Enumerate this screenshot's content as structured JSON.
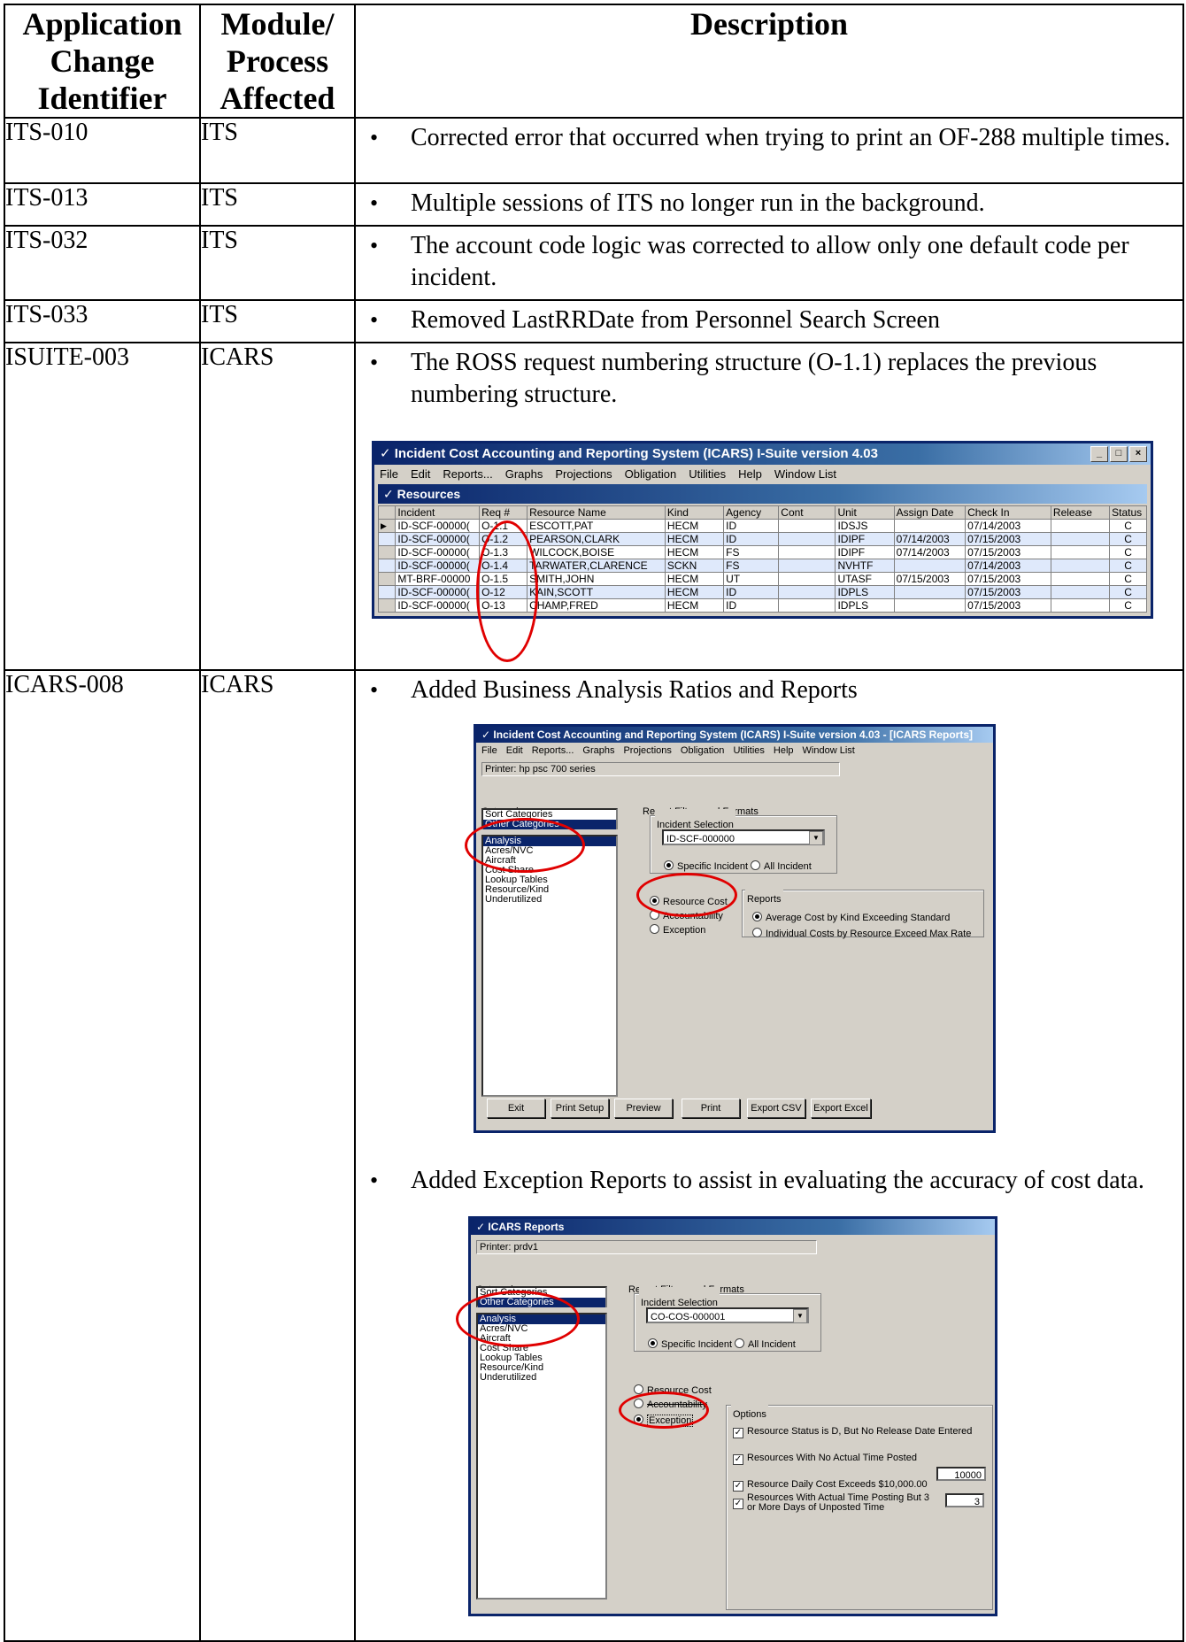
{
  "headers": {
    "identifier": "Application Change Identifier",
    "module": "Module/ Process Affected",
    "description": "Description"
  },
  "rows": [
    {
      "id": "ITS-010",
      "module": "ITS",
      "desc": "Corrected error that occurred when trying to print an OF-288 multiple times."
    },
    {
      "id": "ITS-013",
      "module": "ITS",
      "desc": "Multiple sessions of ITS no longer run in the background."
    },
    {
      "id": "ITS-032",
      "module": "ITS",
      "desc": "The account code logic was corrected to allow only one default code per incident."
    },
    {
      "id": "ITS-033",
      "module": "ITS",
      "desc": "Removed LastRRDate from Personnel Search Screen"
    },
    {
      "id": "ISUITE-003",
      "module": "ICARS",
      "desc": "The ROSS request numbering structure (O-1.1) replaces the previous numbering structure."
    },
    {
      "id": "ICARS-008",
      "module": "ICARS",
      "desc": "Added Business Analysis Ratios and Reports",
      "desc2": "Added Exception Reports to assist in evaluating the accuracy of cost data."
    }
  ],
  "screenshot1": {
    "title": "Incident Cost Accounting and Reporting System (ICARS) I-Suite version 4.03",
    "menu": [
      "File",
      "Edit",
      "Reports...",
      "Graphs",
      "Projections",
      "Obligation",
      "Utilities",
      "Help",
      "Window List"
    ],
    "subwindow": "Resources",
    "columns": [
      "Incident",
      "Req #",
      "Resource Name",
      "Kind",
      "Agency",
      "Cont",
      "Unit",
      "Assign Date",
      "Check In",
      "Release",
      "Status"
    ],
    "rows": [
      [
        "ID-SCF-00000(",
        "O-1.1",
        "ESCOTT,PAT",
        "HECM",
        "ID",
        "",
        "IDSJS",
        "",
        "07/14/2003",
        "",
        "C"
      ],
      [
        "ID-SCF-00000(",
        "O-1.2",
        "PEARSON,CLARK",
        "HECM",
        "ID",
        "",
        "IDIPF",
        "07/14/2003",
        "07/15/2003",
        "",
        "C"
      ],
      [
        "ID-SCF-00000(",
        "O-1.3",
        "WILCOCK,BOISE",
        "HECM",
        "FS",
        "",
        "IDIPF",
        "07/14/2003",
        "07/15/2003",
        "",
        "C"
      ],
      [
        "ID-SCF-00000(",
        "O-1.4",
        "TARWATER,CLARENCE",
        "SCKN",
        "FS",
        "",
        "NVHTF",
        "",
        "07/14/2003",
        "",
        "C"
      ],
      [
        "MT-BRF-00000",
        "O-1.5",
        "SMITH,JOHN",
        "HECM",
        "UT",
        "",
        "UTASF",
        "07/15/2003",
        "07/15/2003",
        "",
        "C"
      ],
      [
        "ID-SCF-00000(",
        "O-12",
        "KAIN,SCOTT",
        "HECM",
        "ID",
        "",
        "IDPLS",
        "",
        "07/15/2003",
        "",
        "C"
      ],
      [
        "ID-SCF-00000(",
        "O-13",
        "CHAMP,FRED",
        "HECM",
        "ID",
        "",
        "IDPLS",
        "",
        "07/15/2003",
        "",
        "C"
      ]
    ]
  },
  "screenshot2": {
    "title": "Incident Cost Accounting and Reporting System (ICARS) I-Suite version 4.03 - [ICARS Reports]",
    "menu": [
      "File",
      "Edit",
      "Reports...",
      "Graphs",
      "Projections",
      "Obligation",
      "Utilities",
      "Help",
      "Window List"
    ],
    "printer": "Printer: hp psc 700 series",
    "categories_label": "Categories",
    "categories_top": [
      "Sort Categories",
      "Other Categories"
    ],
    "categories": [
      "Analysis",
      "Acres/NVC",
      "Aircraft",
      "Cost Share",
      "Lookup Tables",
      "Resource/Kind",
      "Underutilized"
    ],
    "filters_label": "Report Filters and Formats",
    "incident_selection": "Incident Selection",
    "incident_value": "ID-SCF-000000",
    "specific": "Specific Incident",
    "all": "All Incident",
    "type_options": [
      "Resource Cost",
      "Accountability",
      "Exception"
    ],
    "reports_label": "Reports",
    "reports": [
      "Average Cost by Kind Exceeding Standard",
      "Individual Costs by Resource Exceed Max Rate"
    ],
    "buttons": [
      "Exit",
      "Print Setup",
      "Preview",
      "Print",
      "Export CSV",
      "Export Excel"
    ]
  },
  "screenshot3": {
    "title": "ICARS Reports",
    "printer": "Printer: prdv1",
    "categories_label": "Categories",
    "categories_top": [
      "Sort Categories",
      "Other Categories"
    ],
    "categories": [
      "Analysis",
      "Acres/NVC",
      "Aircraft",
      "Cost Share",
      "Lookup Tables",
      "Resource/Kind",
      "Underutilized"
    ],
    "filters_label": "Report Filters and Formats",
    "incident_selection": "Incident Selection",
    "incident_value": "CO-COS-000001",
    "specific": "Specific Incident",
    "all": "All Incident",
    "type_options": [
      "Resource Cost",
      "Accountability",
      "Exception"
    ],
    "options_label": "Options",
    "options": [
      "Resource Status is D, But No Release Date Entered",
      "Resources With No Actual Time Posted",
      "Resource Daily Cost Exceeds $10,000.00",
      "Resources With Actual Time Posting But 3"
    ],
    "option4_line2": "or More Days of Unposted Time",
    "cost_value": "10000",
    "days_value": "3"
  }
}
